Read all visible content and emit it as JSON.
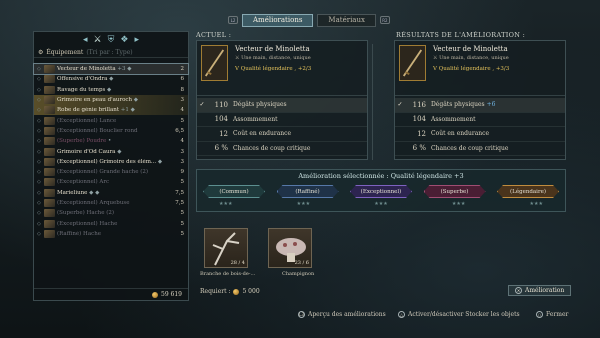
{
  "tabs": {
    "left_key": "L2",
    "right_key": "R2",
    "active": "Améliorations",
    "other": "Matériaux"
  },
  "inventory": {
    "header": "Équipement",
    "sort": "(Tri par : Type)",
    "gold": "59 619",
    "items": [
      {
        "name": "Vecteur de Minoletta",
        "badge": "+3 ◆",
        "value": "2",
        "style": "selected"
      },
      {
        "name": "Offensive d'Ondra",
        "badge": "◆",
        "value": "6",
        "style": "normal"
      },
      {
        "name": "Ravage du temps",
        "badge": "◆",
        "value": "8",
        "style": "normal"
      },
      {
        "name": "Grimoire en peau d'auroch",
        "badge": "◆",
        "value": "3",
        "style": "highlight"
      },
      {
        "name": "Robe de génie brillant",
        "badge": "+1 ◆",
        "value": "4",
        "style": "highlight"
      },
      {
        "name": "(Exceptionnel) Lance",
        "badge": "",
        "value": "5",
        "style": "dim"
      },
      {
        "name": "(Exceptionnel) Bouclier rond",
        "badge": "",
        "value": "6,5",
        "style": "dim"
      },
      {
        "name": "(Superbe) Poudre",
        "badge": "•",
        "value": "4",
        "style": "superbe"
      },
      {
        "name": "Grimoire d'Od Caura",
        "badge": "◆",
        "value": "3",
        "style": "normal"
      },
      {
        "name": "(Exceptionnel) Grimoire des élém...",
        "badge": "◆",
        "value": "3",
        "style": "normal"
      },
      {
        "name": "(Exceptionnel) Grande hache (2)",
        "badge": "",
        "value": "9",
        "style": "dim"
      },
      {
        "name": "(Exceptionnel) Arc",
        "badge": "",
        "value": "5",
        "style": "dim"
      },
      {
        "name": "Marieliune",
        "badge": "◆ ◆",
        "value": "7,5",
        "style": "normal"
      },
      {
        "name": "(Exceptionnel) Arquebuse",
        "badge": "",
        "value": "7,5",
        "style": "dim"
      },
      {
        "name": "(Superbe) Hache (2)",
        "badge": "",
        "value": "5",
        "style": "dim"
      },
      {
        "name": "(Exceptionnel) Hache",
        "badge": "",
        "value": "5",
        "style": "dim"
      },
      {
        "name": "(Raffiné) Hache",
        "badge": "",
        "value": "5",
        "style": "dim"
      }
    ]
  },
  "current": {
    "title": "ACTUEL :",
    "name": "Vecteur de Minoletta",
    "subtitle": "Une main, distance, unique",
    "quality_prefix": "Qualité légendaire ,",
    "quality_bonus": "+2/3",
    "stats": [
      {
        "value": "110",
        "label": "Dégâts physiques",
        "bonus": ""
      },
      {
        "value": "104",
        "label": "Assommement",
        "bonus": ""
      },
      {
        "value": "12",
        "label": "Coût en endurance",
        "bonus": ""
      },
      {
        "value": "6 %",
        "label": "Chances de coup critique",
        "bonus": ""
      }
    ]
  },
  "result": {
    "title": "RÉSULTATS DE L'AMÉLIORATION :",
    "name": "Vecteur de Minoletta",
    "subtitle": "Une main, distance, unique",
    "quality_prefix": "Qualité légendaire ,",
    "quality_bonus": "+3/3",
    "stats": [
      {
        "value": "116",
        "label": "Dégâts physiques",
        "bonus": "+6"
      },
      {
        "value": "104",
        "label": "Assommement",
        "bonus": ""
      },
      {
        "value": "12",
        "label": "Coût en endurance",
        "bonus": ""
      },
      {
        "value": "6 %",
        "label": "Chances de coup critique",
        "bonus": ""
      }
    ]
  },
  "selected_upgrade": {
    "heading": "Amélioration sélectionnée : Qualité légendaire +3",
    "tiers": [
      "(Commun)",
      "(Raffiné)",
      "(Exceptionnel)",
      "(Superbe)",
      "(Légendaire)"
    ],
    "stars": "★★★"
  },
  "materials": [
    {
      "label": "Branche de bois-de-...",
      "qty": "28 / 4"
    },
    {
      "label": "Champignon",
      "qty": "23 / 6"
    }
  ],
  "required": {
    "label": "Requiert :",
    "amount": "5 000"
  },
  "upgrade_button": {
    "key": "✕",
    "label": "Amélioration"
  },
  "footer": [
    {
      "key": "L3",
      "label": "Aperçu des améliorations"
    },
    {
      "key": "△",
      "label": "Activer/désactiver Stocker les objets"
    },
    {
      "key": "○",
      "label": "Fermer"
    }
  ],
  "colors": {
    "legendary": "#e3c25b",
    "bonus": "#6fb2e0",
    "highlight": "#967d37"
  }
}
